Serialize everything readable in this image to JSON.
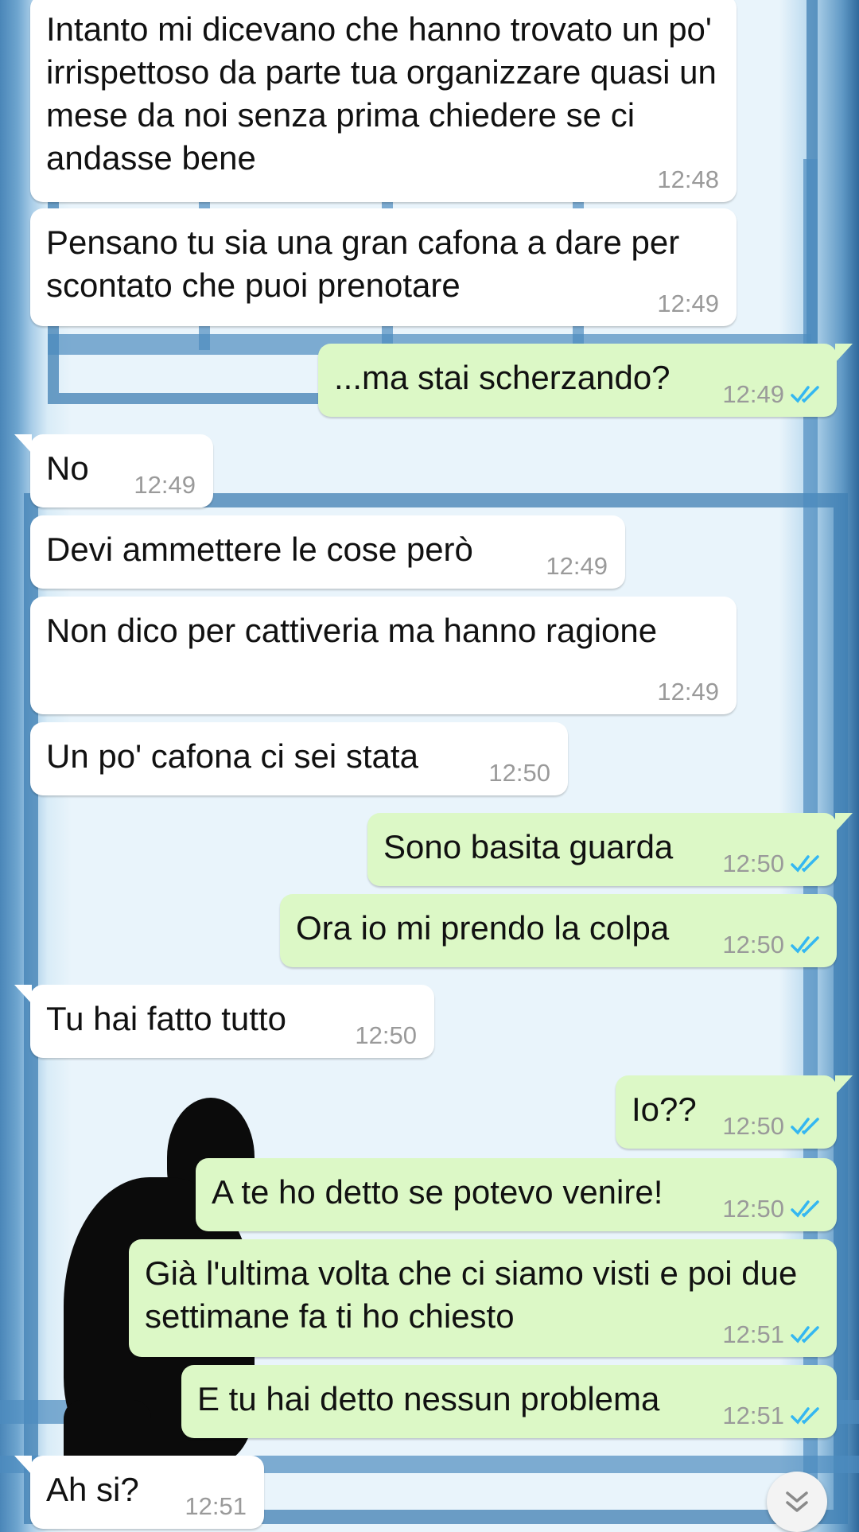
{
  "colors": {
    "incoming_bubble": "#ffffff",
    "outgoing_bubble": "#dcf8c6",
    "timestamp": "#9a9a9a",
    "read_ticks": "#34b7f1"
  },
  "icons": {
    "read_receipt": "double-check-icon",
    "scroll_down": "double-chevron-down-icon"
  },
  "messages": [
    {
      "direction": "in",
      "text": "Intanto mi dicevano che hanno trovato un po' irrispettoso da parte tua organizzare quasi un mese da noi senza prima chiedere se ci andasse bene",
      "time": "12:48"
    },
    {
      "direction": "in",
      "text": "Pensano tu sia una gran cafona a dare per scontato che puoi prenotare",
      "time": "12:49"
    },
    {
      "direction": "out",
      "text": "...ma stai scherzando?",
      "time": "12:49",
      "status": "read"
    },
    {
      "direction": "in",
      "text": "No",
      "time": "12:49"
    },
    {
      "direction": "in",
      "text": "Devi ammettere le cose però",
      "time": "12:49"
    },
    {
      "direction": "in",
      "text": "Non dico per cattiveria ma hanno ragione",
      "time": "12:49"
    },
    {
      "direction": "in",
      "text": "Un po' cafona ci sei stata",
      "time": "12:50"
    },
    {
      "direction": "out",
      "text": "Sono basita guarda",
      "time": "12:50",
      "status": "read"
    },
    {
      "direction": "out",
      "text": "Ora io mi prendo la colpa",
      "time": "12:50",
      "status": "read"
    },
    {
      "direction": "in",
      "text": "Tu hai fatto tutto",
      "time": "12:50"
    },
    {
      "direction": "out",
      "text": "Io??",
      "time": "12:50",
      "status": "read"
    },
    {
      "direction": "out",
      "text": "A te ho detto se potevo venire!",
      "time": "12:50",
      "status": "read"
    },
    {
      "direction": "out",
      "text": "Già l'ultima volta che ci siamo visti e poi due settimane fa ti ho chiesto",
      "time": "12:51",
      "status": "read"
    },
    {
      "direction": "out",
      "text": "E tu hai detto nessun problema",
      "time": "12:51",
      "status": "read"
    },
    {
      "direction": "in",
      "text": "Ah si?",
      "time": "12:51"
    }
  ]
}
